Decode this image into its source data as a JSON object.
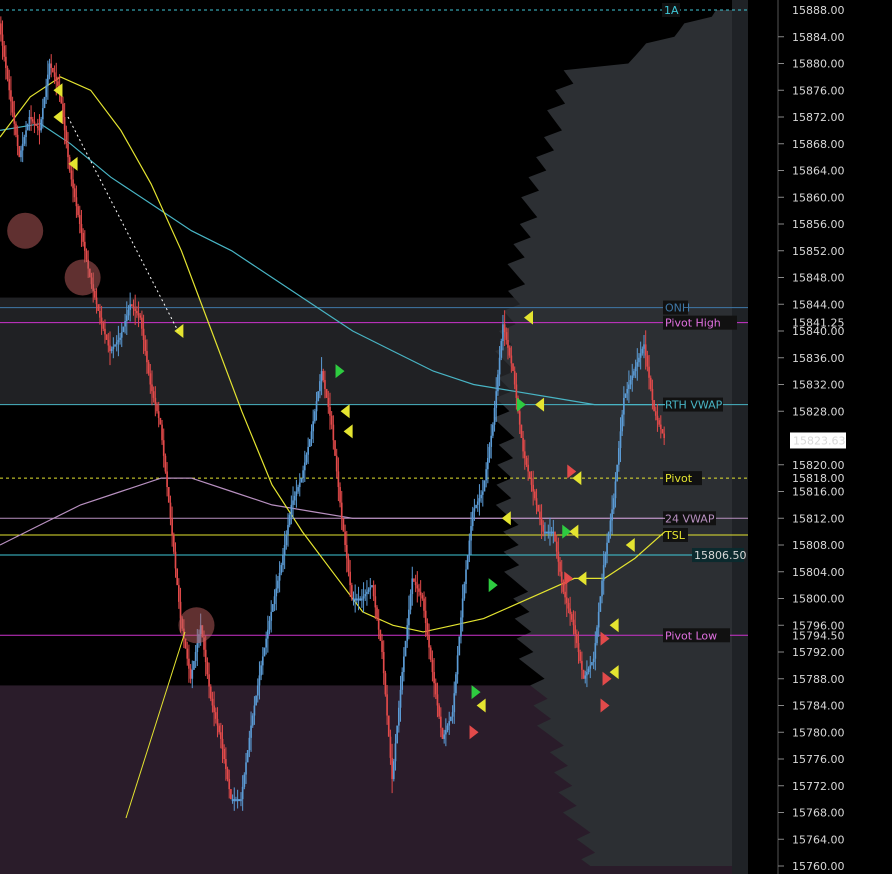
{
  "colors": {
    "background": "#000000",
    "up_candle": "#5b9bd5",
    "down_candle": "#e24a4a",
    "vwap_rth": "#48b4c4",
    "vwap_24": "#b890c0",
    "tsl": "#e4e430",
    "pivot_high": "#cc33cc",
    "pivot_low": "#cc33cc",
    "pivot": "#e4e430",
    "level_1a": "#3fc8d8",
    "level_806": "#3fc8d8",
    "onh": "#3f78a8",
    "profile": "#2c2f33",
    "value_area": "#3a3d42",
    "lower_zone": "#2a1c2a"
  },
  "chart_data": {
    "type": "line",
    "title": "",
    "xlabel": "",
    "ylabel": "",
    "ylim": [
      15760,
      15888
    ],
    "y_ticks": [
      "15884.00",
      "15880.00",
      "15876.00",
      "15872.00",
      "15868.00",
      "15864.00",
      "15860.00",
      "15856.00",
      "15852.00",
      "15848.00",
      "15844.00",
      "15840.00",
      "15836.00",
      "15832.00",
      "15828.00",
      "15820.00",
      "15816.00",
      "15812.00",
      "15808.00",
      "15804.00",
      "15800.00",
      "15796.00",
      "15792.00",
      "15788.00",
      "15784.00",
      "15780.00",
      "15776.00",
      "15772.00",
      "15768.00",
      "15764.00",
      "15760.00"
    ],
    "y_tick_values": [
      15884,
      15880,
      15876,
      15872,
      15868,
      15864,
      15860,
      15856,
      15852,
      15848,
      15844,
      15840,
      15836,
      15832,
      15828,
      15820,
      15816,
      15812,
      15808,
      15804,
      15800,
      15796,
      15792,
      15788,
      15784,
      15780,
      15776,
      15772,
      15768,
      15764,
      15760
    ],
    "price_badge": {
      "label": "15823.63",
      "value": 15823.63
    },
    "levels": [
      {
        "name": "1A",
        "value": 15888,
        "label": "1A",
        "price_label": "15888.00",
        "color": "#3fc8d8",
        "dashed": true
      },
      {
        "name": "ONH",
        "value": 15843.5,
        "label": "ONH",
        "price_label": "",
        "color": "#3f78a8",
        "dashed": false
      },
      {
        "name": "Pivot High",
        "value": 15841.25,
        "label": "Pivot High",
        "price_label": "15841.25",
        "color": "#cc33cc",
        "dashed": false
      },
      {
        "name": "RTH VWAP",
        "value": 15829,
        "label": "RTH VWAP",
        "price_label": "",
        "color": "#48b4c4",
        "dashed": false
      },
      {
        "name": "Pivot",
        "value": 15818,
        "label": "Pivot",
        "price_label": "15818.00",
        "color": "#e4e430",
        "dashed": true
      },
      {
        "name": "24 VWAP",
        "value": 15812,
        "label": "24 VWAP",
        "price_label": "",
        "color": "#b890c0",
        "dashed": false
      },
      {
        "name": "TSL",
        "value": 15809.5,
        "label": "TSL",
        "price_label": "",
        "color": "#e4e430",
        "dashed": false
      },
      {
        "name": "Level",
        "value": 15806.5,
        "label": "",
        "price_label": "15806.50",
        "color": "#3fc8d8",
        "dashed": false
      },
      {
        "name": "Pivot Low",
        "value": 15794.5,
        "label": "Pivot Low",
        "price_label": "15794.50",
        "color": "#cc33cc",
        "dashed": false
      }
    ],
    "series": [
      {
        "name": "price",
        "x": [
          0,
          10,
          20,
          30,
          40,
          50,
          60,
          70,
          80,
          90,
          100,
          110,
          120,
          130,
          140,
          150,
          160,
          170,
          180,
          190,
          200,
          210,
          220,
          230,
          240,
          250,
          260,
          270,
          280,
          290,
          300,
          310,
          320,
          330,
          340,
          350,
          360,
          370,
          380,
          390,
          400,
          410,
          420,
          430,
          440,
          450,
          460,
          470,
          480,
          490,
          500,
          510,
          520,
          530,
          540,
          550,
          560,
          570,
          580,
          590,
          600,
          610,
          620,
          630,
          640,
          650,
          660
        ],
        "values": [
          15886,
          15876,
          15866,
          15872,
          15870,
          15880,
          15876,
          15864,
          15856,
          15848,
          15842,
          15837,
          15839,
          15844,
          15842,
          15832,
          15826,
          15812,
          15797,
          15788,
          15796,
          15785,
          15779,
          15770,
          15770,
          15781,
          15790,
          15798,
          15805,
          15814,
          15818,
          15825,
          15834,
          15826,
          15812,
          15800,
          15800,
          15802,
          15792,
          15773,
          15789,
          15803,
          15800,
          15789,
          15779,
          15783,
          15800,
          15813,
          15816,
          15826,
          15841,
          15834,
          15822,
          15816,
          15810,
          15810,
          15801,
          15796,
          15788,
          15791,
          15805,
          15815,
          15830,
          15834,
          15838,
          15828,
          15824
        ]
      },
      {
        "name": "RTH VWAP",
        "x": [
          0,
          40,
          70,
          110,
          150,
          190,
          230,
          270,
          310,
          350,
          390,
          430,
          470,
          510,
          550,
          590,
          630,
          660
        ],
        "values": [
          15870,
          15871,
          15868,
          15863,
          15859,
          15855,
          15852,
          15848,
          15844,
          15840,
          15837,
          15834,
          15832,
          15831,
          15830,
          15829,
          15829,
          15829
        ]
      },
      {
        "name": "24 VWAP",
        "x": [
          0,
          40,
          80,
          120,
          160,
          190,
          230,
          270,
          310,
          350,
          390,
          430,
          470,
          510,
          550,
          590,
          630,
          660
        ],
        "values": [
          15808,
          15811,
          15814,
          15816,
          15818,
          15818,
          15816,
          15814,
          15813,
          15812,
          15812,
          15812,
          15812,
          15812,
          15812,
          15812,
          15812,
          15812
        ]
      },
      {
        "name": "TSL",
        "x": [
          0,
          30,
          60,
          90,
          120,
          150,
          180,
          210,
          240,
          270,
          300,
          330,
          360,
          390,
          420,
          450,
          480,
          510,
          540,
          570,
          600,
          630,
          660
        ],
        "values": [
          15869,
          15875,
          15878,
          15876,
          15870,
          15862,
          15852,
          15840,
          15828,
          15817,
          15810,
          15804,
          15798,
          15796,
          15795,
          15796,
          15797,
          15799,
          15801,
          15803,
          15803,
          15806,
          15810
        ]
      }
    ],
    "annotation_text": [],
    "grid": false,
    "legend": "none"
  }
}
